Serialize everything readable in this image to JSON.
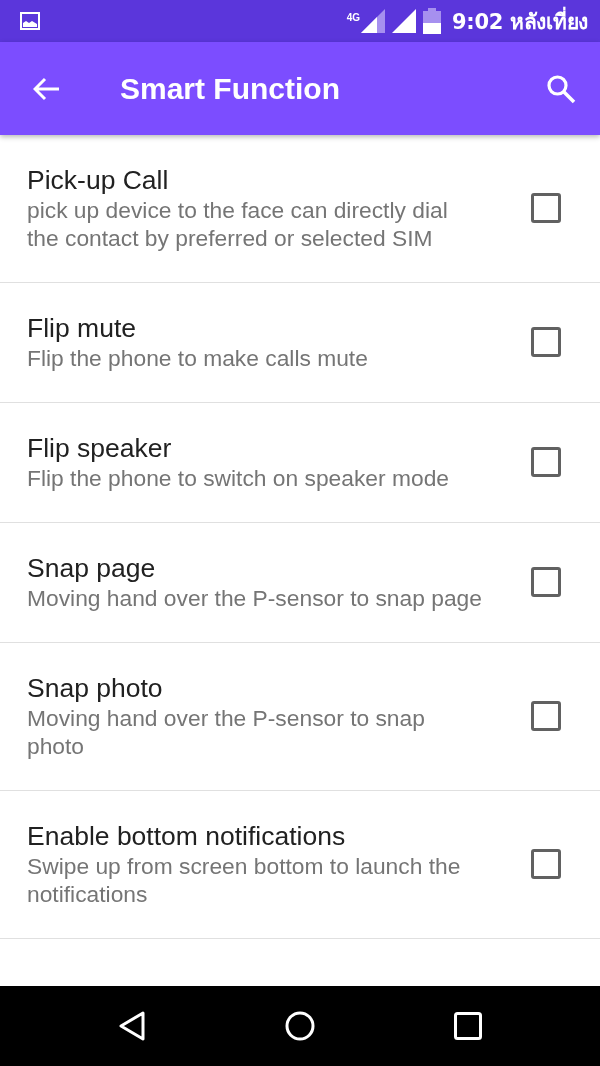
{
  "status_bar": {
    "network": "4G",
    "time": "9:02 หลังเที่ยง"
  },
  "app_bar": {
    "title": "Smart Function"
  },
  "items": [
    {
      "title": "Pick-up Call",
      "summary": "pick up device to the face can directly dial the contact by preferred or selected SIM",
      "checked": false
    },
    {
      "title": "Flip mute",
      "summary": "Flip the phone to make calls mute",
      "checked": false
    },
    {
      "title": "Flip speaker",
      "summary": "Flip the phone to switch on speaker mode",
      "checked": false
    },
    {
      "title": "Snap page",
      "summary": "Moving hand over the P-sensor to snap page",
      "checked": false
    },
    {
      "title": "Snap photo",
      "summary": "Moving hand over the P-sensor to snap photo",
      "checked": false
    },
    {
      "title": "Enable bottom notifications",
      "summary": "Swipe up from screen bottom to launch the notifications",
      "checked": false
    }
  ]
}
